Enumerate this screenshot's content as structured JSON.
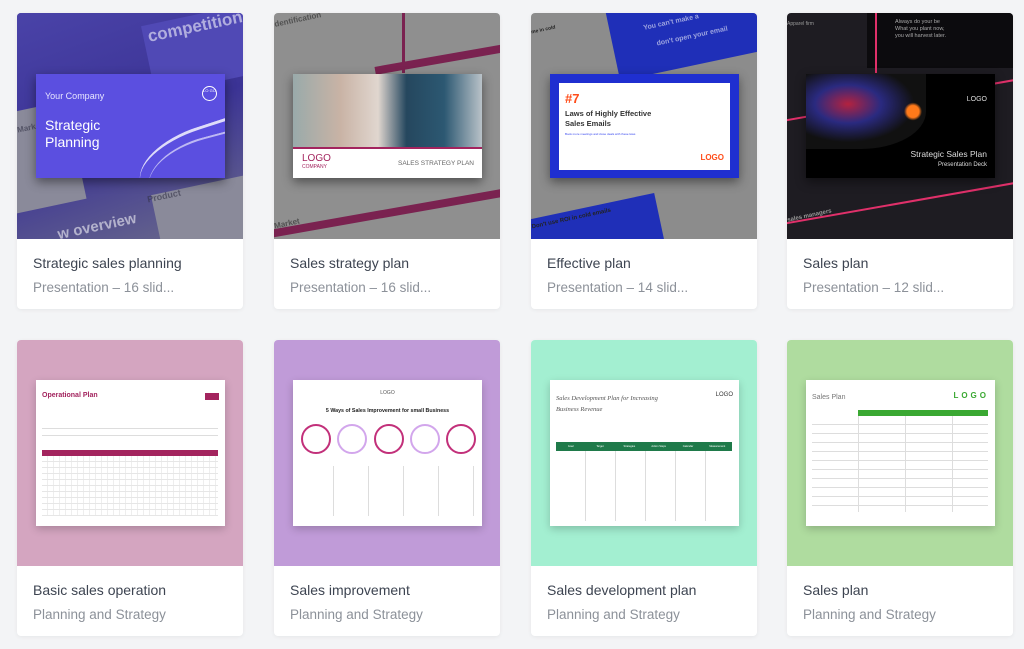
{
  "cards": [
    {
      "title": "Strategic sales planning",
      "subtitle": "Presentation – 16 slid...",
      "thumb": {
        "company": "Your Company",
        "heading_1": "Strategic",
        "heading_2": "Planning",
        "logo": "LO GO",
        "bg_1": "competition",
        "bg_2": "w overview",
        "bg_3": "Product",
        "bg_4": "Market"
      },
      "color": "#5b4fe0"
    },
    {
      "title": "Sales strategy plan",
      "subtitle": "Presentation – 16 slid...",
      "thumb": {
        "logo": "LOGO",
        "logo_sub": "COMPANY",
        "heading": "SALES STRATEGY PLAN",
        "bg_1": "dentification",
        "bg_2": "Market"
      },
      "color": "#a3245e"
    },
    {
      "title": "Effective plan",
      "subtitle": "Presentation – 14 slid...",
      "thumb": {
        "number": "#7",
        "heading_1": "Laws of Highly Effective",
        "heading_2": "Sales Emails",
        "tagline": "Book more meetings and close deals with these laws",
        "logo": "LOGO",
        "bg_1": "You can't make a",
        "bg_2": "don't open your email",
        "bg_3": "Don't use ROI in cold emails",
        "bg_4": "me in cold"
      },
      "color": "#1f2fd0"
    },
    {
      "title": "Sales plan",
      "subtitle": "Presentation – 12 slid...",
      "thumb": {
        "heading": "Strategic Sales Plan",
        "subheading": "Presentation Deck",
        "logo": "LOGO",
        "bg_1": "Always do your be",
        "bg_2": "What you plant now,",
        "bg_3": "you will harvest later.",
        "bg_4": "sales managers",
        "bg_5": "Apparel firm"
      },
      "color": "#e0306a"
    },
    {
      "title": "Basic sales operation",
      "subtitle": "Planning and Strategy",
      "thumb": {
        "heading": "Operational Plan"
      },
      "color": "#d4a5c0"
    },
    {
      "title": "Sales improvement",
      "subtitle": "Planning and Strategy",
      "thumb": {
        "logo": "LOGO",
        "heading": "5 Ways of Sales Improvement for small Business"
      },
      "color": "#c09bd8"
    },
    {
      "title": "Sales development plan",
      "subtitle": "Planning and Strategy",
      "thumb": {
        "heading_1": "Sales Development Plan for Increasing",
        "heading_2": "Business Revenue",
        "logo": "LOGO",
        "columns": [
          "Goal",
          "Target",
          "Strategies",
          "Action Steps",
          "Calendar",
          "Measurement"
        ]
      },
      "color": "#a3efd1"
    },
    {
      "title": "Sales plan",
      "subtitle": "Planning and Strategy",
      "thumb": {
        "heading": "Sales Plan",
        "logo": "LOGO"
      },
      "color": "#afdc9f"
    }
  ]
}
